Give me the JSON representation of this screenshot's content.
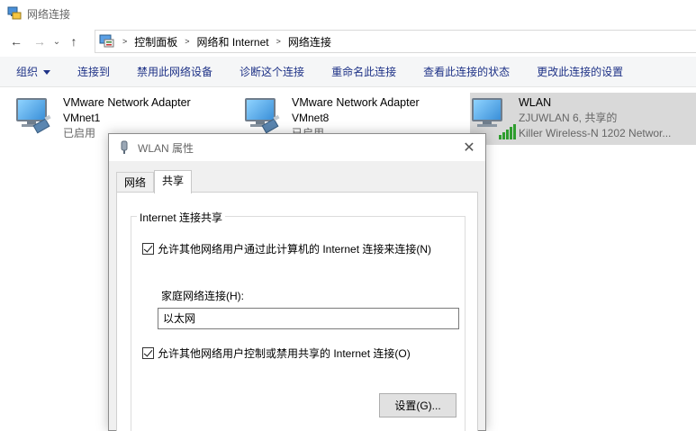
{
  "window": {
    "title": "网络连接"
  },
  "nav": {
    "back": "←",
    "forward": "→",
    "recent": "⌄",
    "up": "↑",
    "breadcrumb": [
      "控制面板",
      "网络和 Internet",
      "网络连接"
    ]
  },
  "commands": [
    "组织",
    "连接到",
    "禁用此网络设备",
    "诊断这个连接",
    "重命名此连接",
    "查看此连接的状态",
    "更改此连接的设置"
  ],
  "adapters": [
    {
      "name": "VMware Network Adapter",
      "line2": "VMnet1",
      "line3": "已启用",
      "icon": "ethernet-adapter-icon"
    },
    {
      "name": "VMware Network Adapter",
      "line2": "VMnet8",
      "line3": "已启用",
      "icon": "ethernet-adapter-icon"
    },
    {
      "name": "WLAN",
      "line2": "ZJUWLAN  6, 共享的",
      "line3": "Killer Wireless-N 1202 Networ...",
      "icon": "wireless-adapter-icon",
      "selected": true
    }
  ],
  "dialog": {
    "title": "WLAN 属性",
    "close": "✕",
    "tabs": [
      "网络",
      "共享"
    ],
    "active_tab": "共享",
    "group_title": "Internet 连接共享",
    "checkbox1": {
      "label": "允许其他网络用户通过此计算机的 Internet 连接来连接(N)",
      "checked": true
    },
    "home_label": "家庭网络连接(H):",
    "home_value": "以太网",
    "checkbox2": {
      "label": "允许其他网络用户控制或禁用共享的 Internet 连接(O)",
      "checked": true
    },
    "settings_button": "设置(G)..."
  },
  "colors": {
    "command_text": "#1e3287",
    "selected_bg": "#d9d9d9",
    "signal_green": "#2e9d2e"
  }
}
